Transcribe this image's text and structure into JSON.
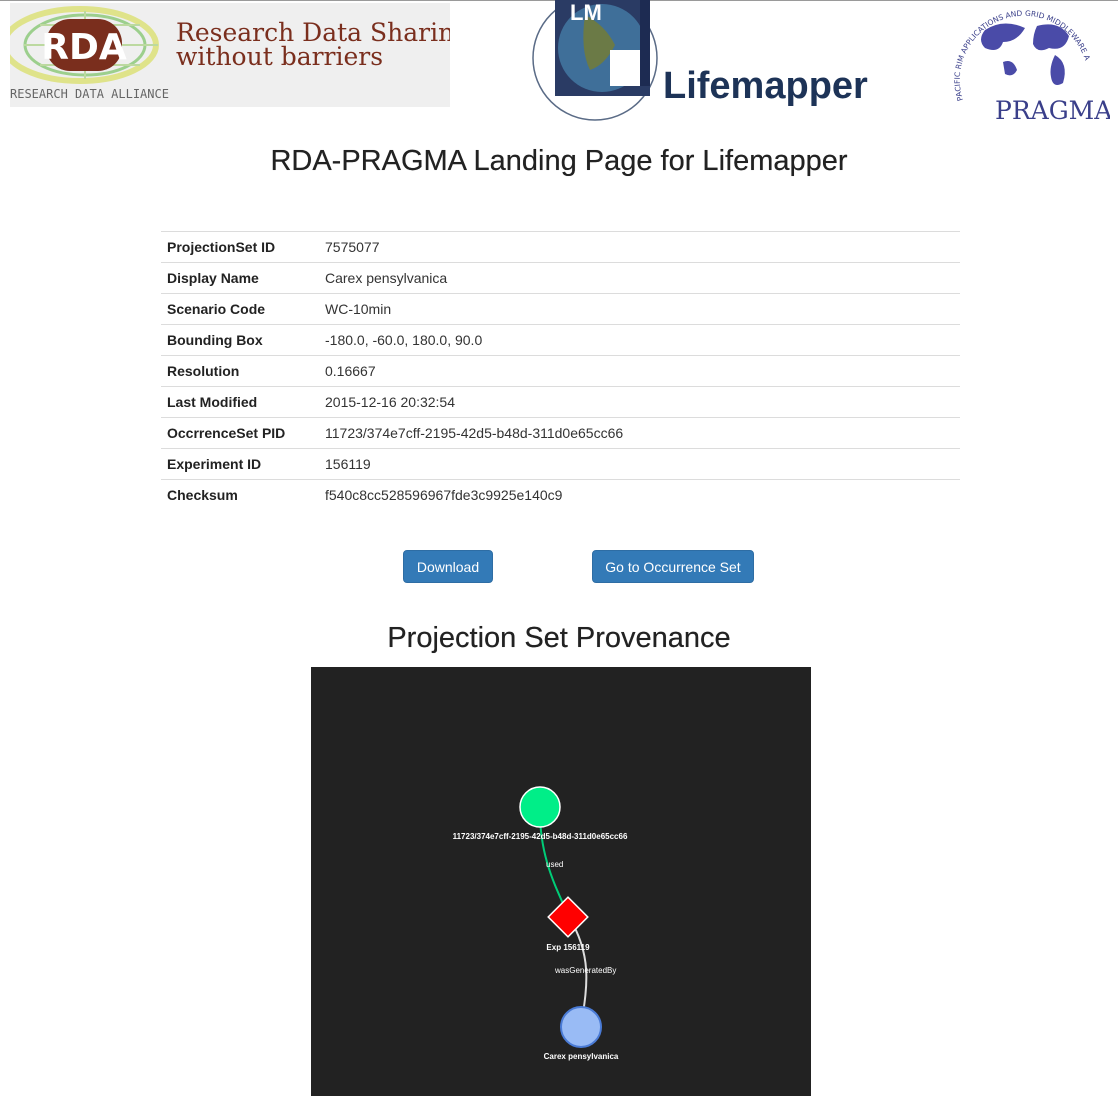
{
  "logos": {
    "rda_abbrev": "RDA",
    "rda_tagline_line1": "Research Data Sharing",
    "rda_tagline_line2": "without barriers",
    "rda_org_name": "RESEARCH DATA ALLIANCE",
    "lifemapper_name": "Lifemapper",
    "lifemapper_abbrev": "LM",
    "pragma_name": "PRAGMA",
    "pragma_arc_text": "PACIFIC RIM APPLICATIONS AND GRID MIDDLEWARE ASSEMBLY"
  },
  "page_title": "RDA-PRAGMA Landing Page for Lifemapper",
  "metadata": [
    {
      "key": "ProjectionSet ID",
      "value": "7575077"
    },
    {
      "key": "Display Name",
      "value": "Carex pensylvanica"
    },
    {
      "key": "Scenario Code",
      "value": "WC-10min"
    },
    {
      "key": "Bounding Box",
      "value": "-180.0, -60.0, 180.0, 90.0"
    },
    {
      "key": "Resolution",
      "value": "0.16667"
    },
    {
      "key": "Last Modified",
      "value": "2015-12-16 20:32:54"
    },
    {
      "key": "OccrrenceSet PID",
      "value": "11723/374e7cff-2195-42d5-b48d-311d0e65cc66"
    },
    {
      "key": "Experiment ID",
      "value": "156119"
    },
    {
      "key": "Checksum",
      "value": "f540c8cc528596967fde3c9925e140c9"
    }
  ],
  "buttons": {
    "download": "Download",
    "occurrence": "Go to Occurrence Set"
  },
  "provenance": {
    "title": "Projection Set Provenance",
    "nodes": {
      "occurrence": {
        "label": "11723/374e7cff-2195-42d5-b48d-311d0e65cc66",
        "color": "#00ee88"
      },
      "experiment": {
        "label": "Exp 156119",
        "color": "#ff0000"
      },
      "projection": {
        "label": "Carex pensylvanica",
        "color": "#99bbf5"
      }
    },
    "edges": {
      "used": {
        "label": "used",
        "color": "#00cc77"
      },
      "generated": {
        "label": "wasGeneratedBy",
        "color": "#dddddd"
      }
    },
    "background": "#222222"
  },
  "colors": {
    "button": "#337ab7",
    "rda_brown": "#7a2e1d"
  }
}
